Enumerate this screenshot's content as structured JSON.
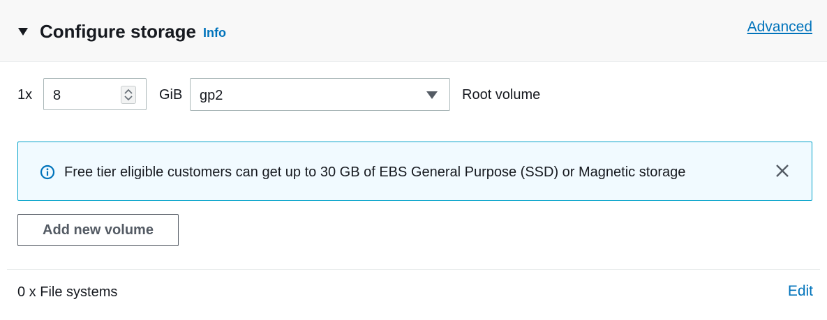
{
  "header": {
    "title": "Configure storage",
    "info_label": "Info",
    "advanced_label": "Advanced",
    "collapse_icon": "caret-down-icon"
  },
  "volume": {
    "count_label": "1x",
    "size_value": "8",
    "size_unit": "GiB",
    "type_value": "gp2",
    "volume_label": "Root volume",
    "spinner_icon": "spinner-up-down-icon",
    "dropdown_icon": "caret-down-icon"
  },
  "alert": {
    "text": "Free tier eligible customers can get up to 30 GB of EBS General Purpose (SSD) or Magnetic storage",
    "icon": "info-circle-icon",
    "close_icon": "close-icon",
    "border_color": "#00a1c9",
    "background_color": "#f1faff"
  },
  "actions": {
    "add_volume_label": "Add new volume"
  },
  "file_systems": {
    "label": "0 x File systems",
    "edit_label": "Edit"
  },
  "colors": {
    "link": "#0073bb",
    "text": "#16191f",
    "header_bg": "#f8f8f8"
  }
}
